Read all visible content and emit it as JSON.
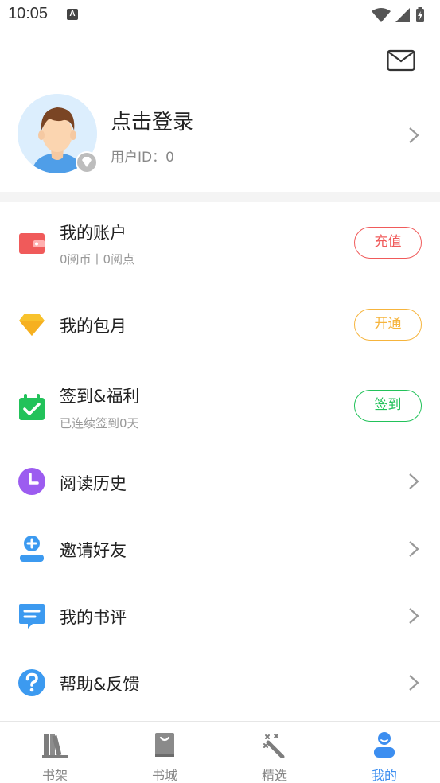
{
  "status_bar": {
    "time": "10:05",
    "notif_letter": "A"
  },
  "profile": {
    "login_text": "点击登录",
    "user_id": "用户ID：0"
  },
  "menu": {
    "account": {
      "title": "我的账户",
      "subtitle": "0阅币丨0阅点",
      "button": "充值",
      "color": "#f05a5a"
    },
    "monthly": {
      "title": "我的包月",
      "button": "开通",
      "color": "#f6b43c"
    },
    "checkin": {
      "title": "签到&福利",
      "subtitle": "已连续签到0天",
      "button": "签到",
      "color": "#22c25a"
    },
    "history": {
      "title": "阅读历史",
      "color": "#9c5cf0"
    },
    "invite": {
      "title": "邀请好友",
      "color": "#3c9af0"
    },
    "reviews": {
      "title": "我的书评",
      "color": "#3c9af0"
    },
    "help": {
      "title": "帮助&反馈",
      "color": "#3c9af0"
    }
  },
  "tabs": [
    {
      "label": "书架",
      "icon": "bookshelf-icon"
    },
    {
      "label": "书城",
      "icon": "bookstore-icon"
    },
    {
      "label": "精选",
      "icon": "featured-icon"
    },
    {
      "label": "我的",
      "icon": "profile-icon",
      "active": true
    }
  ],
  "colors": {
    "accent": "#3c8ef0",
    "divider": "#f4f4f4"
  }
}
